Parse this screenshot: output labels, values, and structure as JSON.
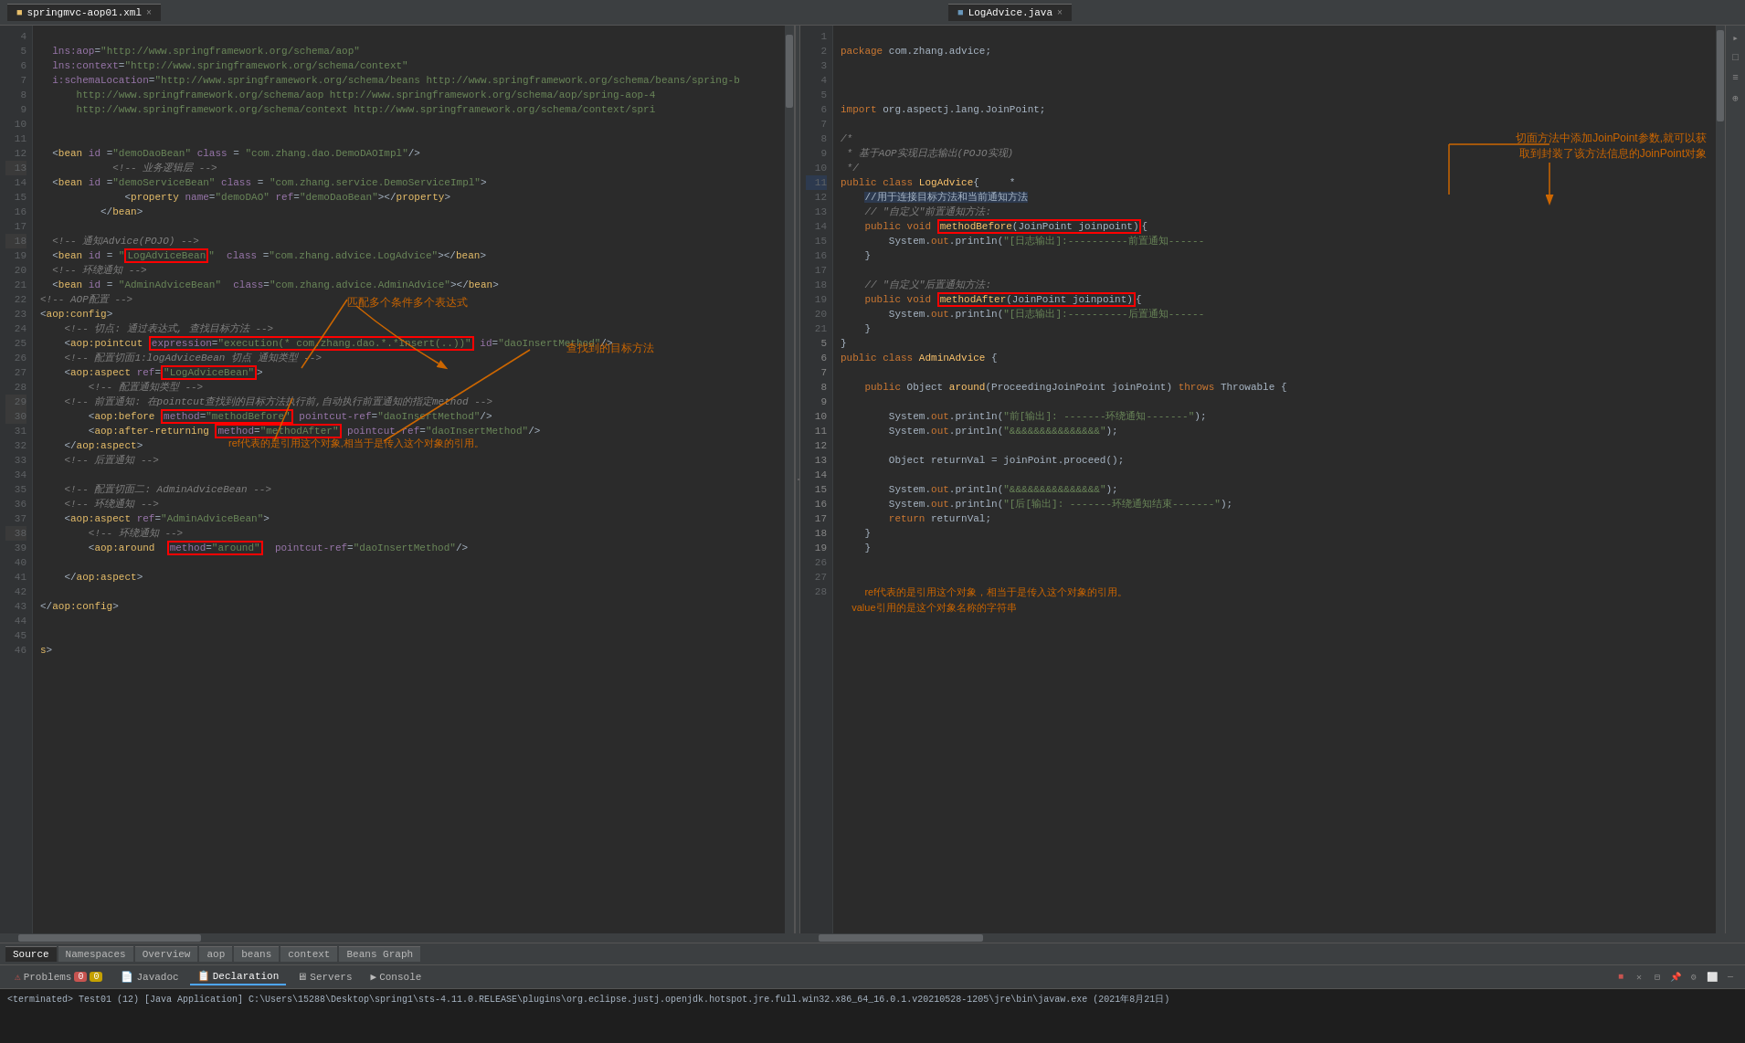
{
  "tabs": {
    "left": {
      "label": "springmvc-aop01.xml",
      "icon": "xml-icon",
      "close": "×"
    },
    "right": {
      "label": "LogAdvice.java",
      "icon": "java-icon",
      "close": "×"
    }
  },
  "left_editor": {
    "lines": [
      {
        "num": "4",
        "code": "  lns:aop=\"http://www.springframework.org/schema/aop\""
      },
      {
        "num": "5",
        "code": "  lns:context=\"http://www.springframework.org/schema/context\""
      },
      {
        "num": "6",
        "code": "  i:schemaLocation=\"http://www.springframework.org/schema/beans http://www.springframework.org/schema/beans/spring-b"
      },
      {
        "num": "7",
        "code": "      http://www.springframework.org/schema/aop http://www.springframework.org/schema/aop/spring-aop-4"
      },
      {
        "num": "8",
        "code": "      http://www.springframework.org/schema/context http://www.springframework.org/schema/context/spri"
      },
      {
        "num": "9",
        "code": ""
      },
      {
        "num": "11",
        "code": "  <bean id =\"demoDaoBean\" class = \"com.zhang.dao.DemoDAOImpl\"/>"
      },
      {
        "num": "12",
        "code": "            <!-- 业务逻辑层 -->"
      },
      {
        "num": "13",
        "code": "  <bean id =\"demoServiceBean\" class = \"com.zhang.service.DemoServiceImpl\">"
      },
      {
        "num": "14",
        "code": "              <property name=\"demoDAO\" ref=\"demoDaoBean\"></property>"
      },
      {
        "num": "15",
        "code": "          </bean>"
      },
      {
        "num": "16",
        "code": ""
      },
      {
        "num": "17",
        "code": "  <!-- 通知Advice(POJO) -->"
      },
      {
        "num": "18",
        "code": "  <bean id = \"LogAdviceBean\"  class =\"com.zhang.advice.LogAdvice\"></bean>"
      },
      {
        "num": "19",
        "code": "  <!-- 环绕通知 -->"
      },
      {
        "num": "20",
        "code": "  <bean id = \"AdminAdviceBean\"  class=\"com.zhang.advice.AdminAdvice\"></bean>"
      },
      {
        "num": "21",
        "code": "<!-- AOP配置 -->"
      },
      {
        "num": "22",
        "code": "<aop:config>"
      },
      {
        "num": "23",
        "code": "    <!-- 切点: 通过表达式, 查找目标方法 -->"
      },
      {
        "num": "24",
        "code": "    <aop:pointcut expression=\"execution(* com.zhang.dao.*.*Insert(..))\" id=\"daoInsertMethod\"/>"
      },
      {
        "num": "25",
        "code": "    <!-- 配置切面1:logAdviceBean 切点 通知类型 -->"
      },
      {
        "num": "26",
        "code": "    <aop:aspect ref=\"LogAdviceBean\">"
      },
      {
        "num": "27",
        "code": "        <!-- 配置通知类型 -->"
      },
      {
        "num": "28",
        "code": "    <!-- 前置通知: 在pointcut查找到的目标方法执行前,自动执行前置通知的指定method -->"
      },
      {
        "num": "29",
        "code": "        <aop:before method=\"methodBefore\" pointcut-ref=\"daoInsertMethod\"/>"
      },
      {
        "num": "30",
        "code": "        <aop:after-returning method=\"methodAfter\" pointcut-ref=\"daoInsertMethod\"/>"
      },
      {
        "num": "31",
        "code": "    </aop:aspect>"
      },
      {
        "num": "32",
        "code": "    <!-- 后置通知 -->"
      },
      {
        "num": "33",
        "code": ""
      },
      {
        "num": "34",
        "code": "    <!-- 配置切面二: AdminAdviceBean -->"
      },
      {
        "num": "35",
        "code": "    <!-- 环绕通知 -->"
      },
      {
        "num": "36",
        "code": "    <aop:aspect ref=\"AdminAdviceBean\">"
      },
      {
        "num": "37",
        "code": "        <!-- 环绕通知 -->"
      },
      {
        "num": "38",
        "code": "        <aop:around  method=\"around\"  pointcut-ref=\"daoInsertMethod\"/>"
      },
      {
        "num": "39",
        "code": ""
      },
      {
        "num": "40",
        "code": "    </aop:aspect>"
      },
      {
        "num": "41",
        "code": ""
      },
      {
        "num": "42",
        "code": "</aop:config>"
      },
      {
        "num": "43",
        "code": ""
      },
      {
        "num": "44",
        "code": ""
      },
      {
        "num": "45",
        "code": "s>"
      },
      {
        "num": "46",
        "code": ""
      }
    ]
  },
  "right_editor": {
    "lines": [
      {
        "num": "1",
        "code": "package com.zhang.advice;"
      },
      {
        "num": "2",
        "code": ""
      },
      {
        "num": "3",
        "code": ""
      },
      {
        "num": "4",
        "code": ""
      },
      {
        "num": "5",
        "code": "import org.aspectj.lang.JoinPoint;"
      },
      {
        "num": "6",
        "code": ""
      },
      {
        "num": "7",
        "code": "/* "
      },
      {
        "num": "8",
        "code": " * 基于AOP实现日志输出(POJO实现)"
      },
      {
        "num": "9",
        "code": " */"
      },
      {
        "num": "10",
        "code": "public class LogAdvice{     *"
      },
      {
        "num": "11",
        "code": "    //用于连接目标方法和当前通知方法"
      },
      {
        "num": "12",
        "code": "    // \"自定义\"前置通知方法:"
      },
      {
        "num": "13",
        "code": "    public void methodBefore(JoinPoint joinpoint){"
      },
      {
        "num": "14",
        "code": "        System.out.println(\"[日志输出]:----------前置通知------"
      },
      {
        "num": "15",
        "code": "    }"
      },
      {
        "num": "16",
        "code": ""
      },
      {
        "num": "17",
        "code": "    // \"自定义\"后置通知方法:"
      },
      {
        "num": "18",
        "code": "    public void methodAfter(JoinPoint joinpoint){"
      },
      {
        "num": "19",
        "code": "        System.out.println(\"[日志输出]:----------后置通知------"
      },
      {
        "num": "20",
        "code": "    }"
      },
      {
        "num": "21",
        "code": "}"
      },
      {
        "num": "5",
        "code": "public class AdminAdvice {"
      },
      {
        "num": "6",
        "code": ""
      },
      {
        "num": "7",
        "code": "    public Object around(ProceedingJoinPoint joinPoint) throws Throwable {"
      },
      {
        "num": "8",
        "code": ""
      },
      {
        "num": "9",
        "code": "        System.out.println(\"前[输出]: -------环绕通知-------\");"
      },
      {
        "num": "10",
        "code": "        System.out.println(\"&&&&&&&&&&&&&&&\");"
      },
      {
        "num": "11",
        "code": ""
      },
      {
        "num": "12",
        "code": "        Object returnVal = joinPoint.proceed();"
      },
      {
        "num": "13",
        "code": ""
      },
      {
        "num": "14",
        "code": "        System.out.println(\"&&&&&&&&&&&&&&&\");"
      },
      {
        "num": "15",
        "code": "        System.out.println(\"[后[输出]: -------环绕通知结束-------\");"
      },
      {
        "num": "16",
        "code": "        return returnVal;"
      },
      {
        "num": "17",
        "code": "    }"
      },
      {
        "num": "18",
        "code": "    }"
      },
      {
        "num": "19",
        "code": ""
      },
      {
        "num": "26",
        "code": ""
      },
      {
        "num": "27",
        "code": "    value引用的是这个对象名称的字符串"
      },
      {
        "num": "28",
        "code": ""
      }
    ]
  },
  "annotations": {
    "right_comment1": "切面方法中添加JoinPoint参数,就可以获",
    "right_comment2": "取到封装了该方法信息的JoinPoint对象",
    "arrow_label1": "匹配多个条件多个表达式",
    "arrow_label2": "查找到的目标方法",
    "arrow_label3": "ref代表的是引用这个对象,相当于是传入这个对象的引用。",
    "ref_comment": "ref代表的是引用这个对象，相当于是传入这个对象的引用。",
    "value_comment": "value引用的是这个对象名称的字符串"
  },
  "bottom_tabs": [
    {
      "label": "Source",
      "active": true
    },
    {
      "label": "Namespaces",
      "active": false
    },
    {
      "label": "Overview",
      "active": false
    },
    {
      "label": "aop",
      "active": false
    },
    {
      "label": "beans",
      "active": false
    },
    {
      "label": "context",
      "active": false
    },
    {
      "label": "Beans Graph",
      "active": false
    }
  ],
  "problems_tabs": [
    {
      "label": "Problems",
      "active": false,
      "icon": "warning-icon"
    },
    {
      "label": "Javadoc",
      "active": false,
      "icon": "doc-icon"
    },
    {
      "label": "Declaration",
      "active": true,
      "icon": "declaration-icon"
    },
    {
      "label": "Servers",
      "active": false,
      "icon": "server-icon"
    },
    {
      "label": "Console",
      "active": false,
      "icon": "console-icon"
    }
  ],
  "console_text": "<terminated> Test01 (12) [Java Application] C:\\Users\\15288\\Desktop\\spring1\\sts-4.11.0.RELEASE\\plugins\\org.eclipse.justj.openjdk.hotspot.jre.full.win32.x86_64_16.0.1.v20210528-1205\\jre\\bin\\javaw.exe  (2021年8月21日)"
}
